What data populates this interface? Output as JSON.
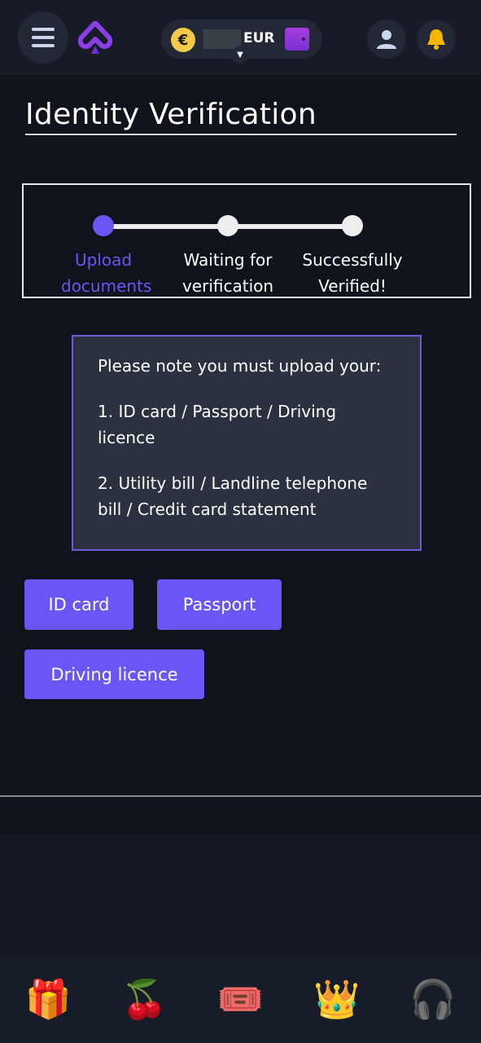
{
  "header": {
    "currency": "EUR",
    "coin_symbol": "€",
    "icons": [
      "menu-icon",
      "spade-logo",
      "euro-coin-icon",
      "wallet-icon",
      "chevron-down-icon",
      "user-icon",
      "bell-icon"
    ]
  },
  "page": {
    "title": "Identity Verification"
  },
  "steps": [
    {
      "label": "Upload documents",
      "active": true
    },
    {
      "label": "Waiting for verification",
      "active": false
    },
    {
      "label": "Successfully Verified!",
      "active": false
    }
  ],
  "note": {
    "intro": "Please note you must upload your:",
    "item1": "1. ID card / Passport / Driving licence",
    "item2": "2. Utility bill / Landline telephone bill / Credit card statement"
  },
  "buttons": {
    "id_card": "ID card",
    "passport": "Passport",
    "driving_licence": "Driving licence"
  },
  "nav": [
    {
      "icon": "gift-icon",
      "glyph": "🎁"
    },
    {
      "icon": "cherries-icon",
      "glyph": "🍒"
    },
    {
      "icon": "ticket-icon",
      "glyph": "🎟️"
    },
    {
      "icon": "crown-icon",
      "glyph": "👑"
    },
    {
      "icon": "headset-icon",
      "glyph": "🎧"
    }
  ],
  "colors": {
    "accent": "#6a55f5",
    "active_step": "#6a55f5",
    "background": "#10131c"
  }
}
